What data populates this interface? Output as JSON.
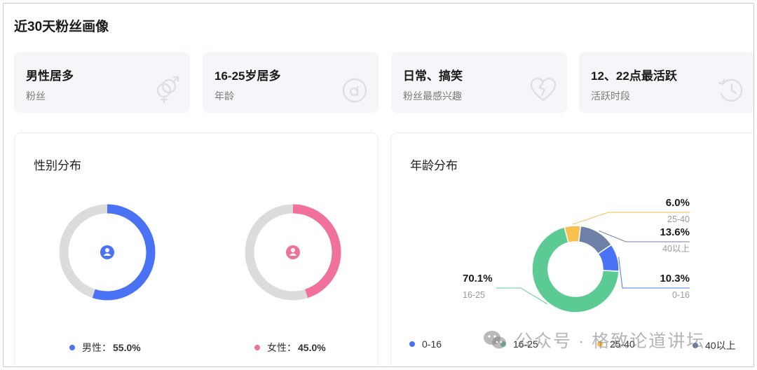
{
  "title": "近30天粉丝画像",
  "summary": [
    {
      "head": "男性居多",
      "sub": "粉丝",
      "icon": "gender-icon"
    },
    {
      "head": "16-25岁居多",
      "sub": "年龄",
      "icon": "age-icon"
    },
    {
      "head": "日常、搞笑",
      "sub": "粉丝最感兴趣",
      "icon": "heart-icon"
    },
    {
      "head": "12、22点最活跃",
      "sub": "活跃时段",
      "icon": "clock-icon"
    }
  ],
  "gender": {
    "title": "性别分布",
    "male": {
      "label": "男性：",
      "value": "55.0%",
      "fraction": 0.55,
      "color": "#4a72f5"
    },
    "female": {
      "label": "女性：",
      "value": "45.0%",
      "fraction": 0.45,
      "color": "#f07199"
    },
    "track_color": "#dcdcdc"
  },
  "age": {
    "title": "年龄分布",
    "legend": [
      "0-16",
      "16-25",
      "25-40",
      "40以上"
    ]
  },
  "chart_data": {
    "type": "pie",
    "title": "年龄分布",
    "categories": [
      "0-16",
      "16-25",
      "25-40",
      "40以上"
    ],
    "values": [
      10.3,
      70.1,
      6.0,
      13.6
    ],
    "labels": [
      "10.3%",
      "70.1%",
      "6.0%",
      "13.6%"
    ],
    "colors": [
      "#4a72f5",
      "#5ccb93",
      "#f7c14d",
      "#6c80a8"
    ],
    "legend": "bottom",
    "donut": true
  },
  "watermark": {
    "text": "公众号 · 格致论道讲坛"
  }
}
